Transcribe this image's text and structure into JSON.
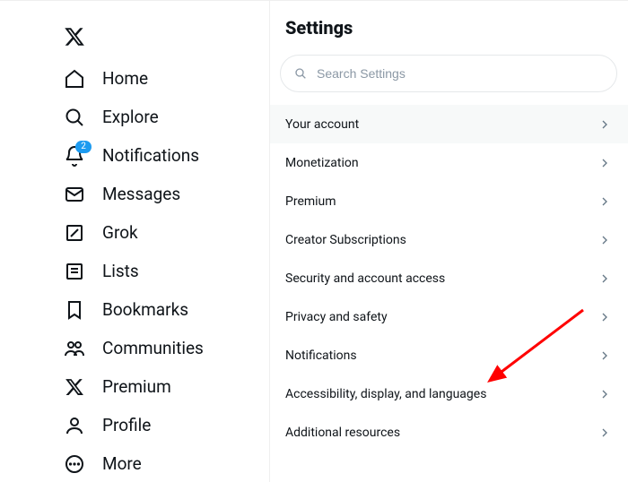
{
  "sidebar": {
    "items": [
      {
        "label": "Home"
      },
      {
        "label": "Explore"
      },
      {
        "label": "Notifications",
        "badge": "2"
      },
      {
        "label": "Messages"
      },
      {
        "label": "Grok"
      },
      {
        "label": "Lists"
      },
      {
        "label": "Bookmarks"
      },
      {
        "label": "Communities"
      },
      {
        "label": "Premium"
      },
      {
        "label": "Profile"
      },
      {
        "label": "More"
      }
    ]
  },
  "main": {
    "title": "Settings",
    "search_placeholder": "Search Settings",
    "items": [
      {
        "label": "Your account"
      },
      {
        "label": "Monetization"
      },
      {
        "label": "Premium"
      },
      {
        "label": "Creator Subscriptions"
      },
      {
        "label": "Security and account access"
      },
      {
        "label": "Privacy and safety"
      },
      {
        "label": "Notifications"
      },
      {
        "label": "Accessibility, display, and languages"
      },
      {
        "label": "Additional resources"
      }
    ],
    "active_index": 0
  },
  "annotation": {
    "type": "arrow",
    "target_index": 7
  }
}
